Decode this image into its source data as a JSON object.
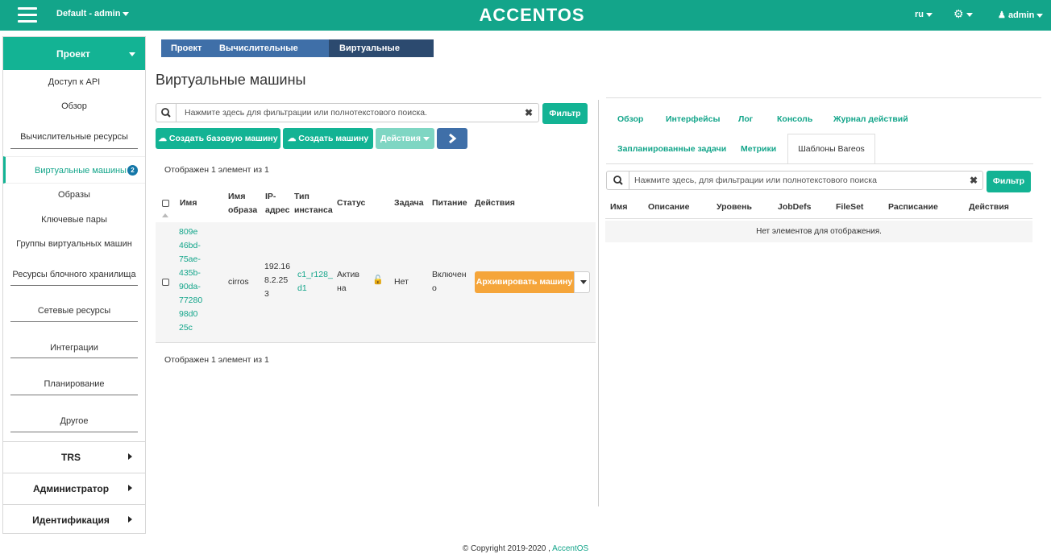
{
  "topbar": {
    "project": "Default - admin",
    "brand": "ACCENTOS",
    "lang": "ru",
    "user": "admin",
    "bg_color": "#13a58a"
  },
  "sidebar": {
    "header": "Проект",
    "items": [
      {
        "label": "Доступ к API"
      },
      {
        "label": "Обзор"
      },
      {
        "label": "Вычислительные ресурсы"
      },
      {
        "label": "Виртуальные машины",
        "badge": "2",
        "active": true
      },
      {
        "label": "Образы"
      },
      {
        "label": "Ключевые пары"
      },
      {
        "label": "Группы виртуальных машин"
      },
      {
        "label": "Ресурсы блочного хранилища"
      },
      {
        "label": "Сетевые ресурсы"
      },
      {
        "label": "Интеграции"
      },
      {
        "label": "Планирование"
      },
      {
        "label": "Другое"
      }
    ],
    "groups": [
      "TRS",
      "Администратор",
      "Идентификация"
    ]
  },
  "breadcrumb": [
    "Проект",
    "Вычислительные ресурсы",
    "Виртуальные машины"
  ],
  "page_title": "Виртуальные машины",
  "left": {
    "search_placeholder": "Нажмите здесь  для фильтрации или полнотекстового поиска.",
    "filter_btn": "Фильтр",
    "create_base_btn": "Создать базовую машину",
    "create_btn": "Создать машину",
    "actions_btn": "Действия",
    "info_text": "Отображен 1 элемент из 1",
    "columns": [
      "Имя",
      "Имя образа",
      "IP-адрес",
      "Тип инстанса",
      "Статус",
      "Задача",
      "Питание",
      "Действия"
    ],
    "row": {
      "name_lines": [
        "809e",
        "46bd-",
        "75ae-",
        "435b-",
        "90da-",
        "77280",
        "98d0",
        "25c"
      ],
      "image": "cirros",
      "ip_lines": [
        "192.16",
        "8.2.25",
        "3"
      ],
      "flavor_lines": [
        "c1_r128_",
        "d1"
      ],
      "status_lines": [
        "Актив",
        "на"
      ],
      "task": "Нет",
      "power_lines": [
        "Включен",
        "о"
      ],
      "action": "Архивировать машину"
    }
  },
  "right": {
    "tabs_row1": [
      "Обзор",
      "Интерфейсы",
      "Лог",
      "Консоль",
      "Журнал действий"
    ],
    "tabs_row2": [
      "Запланированные задачи",
      "Метрики"
    ],
    "active_tab": "Шаблоны Bareos",
    "search_placeholder": "Нажмите здесь, для фильтрации или полнотекстового поиска",
    "filter_btn": "Фильтр",
    "columns": [
      "Имя",
      "Описание",
      "Уровень",
      "JobDefs",
      "FileSet",
      "Расписание",
      "Действия"
    ],
    "empty_text": "Нет элементов для отображения."
  },
  "footer": {
    "text": "© Copyright 2019-2020 ,",
    "link": "AccentOS"
  }
}
